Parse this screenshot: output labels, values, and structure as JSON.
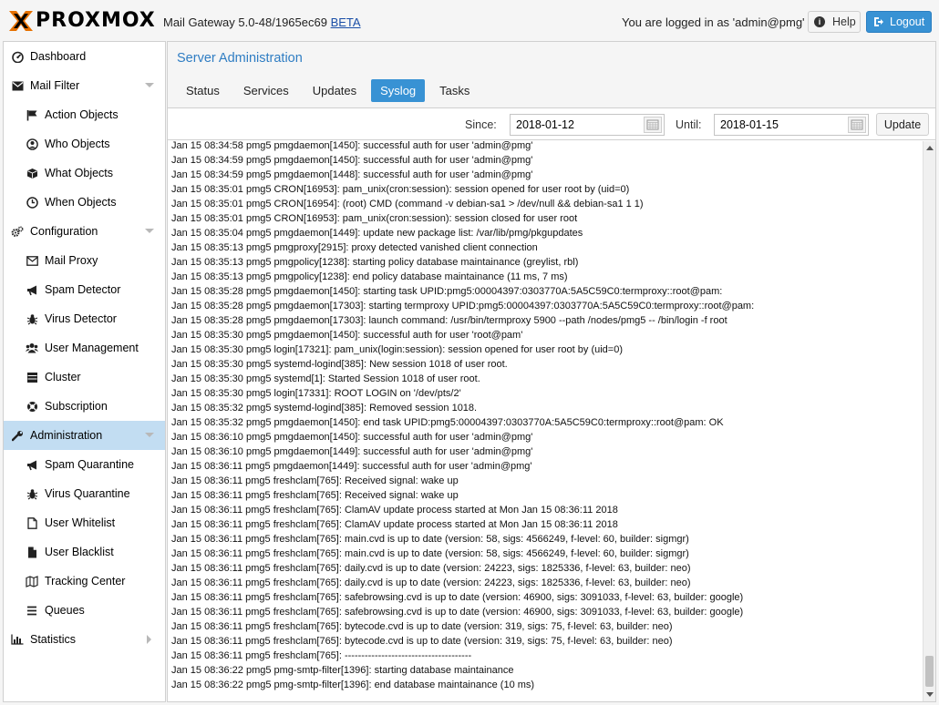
{
  "header": {
    "brand": "PROXMOX",
    "version_text": "Mail Gateway 5.0-48/1965ec69",
    "beta_link": "BETA",
    "logged_in_text": "You are logged in as 'admin@pmg'",
    "help_label": "Help",
    "logout_label": "Logout"
  },
  "sidebar": {
    "items": [
      {
        "label": "Dashboard",
        "icon": "dashboard-icon"
      },
      {
        "label": "Mail Filter",
        "icon": "envelope-icon"
      },
      {
        "label": "Action Objects",
        "icon": "flag-icon"
      },
      {
        "label": "Who Objects",
        "icon": "user-circle-icon"
      },
      {
        "label": "What Objects",
        "icon": "cube-icon"
      },
      {
        "label": "When Objects",
        "icon": "clock-icon"
      },
      {
        "label": "Configuration",
        "icon": "cogs-icon"
      },
      {
        "label": "Mail Proxy",
        "icon": "envelope-outline-icon"
      },
      {
        "label": "Spam Detector",
        "icon": "bullhorn-icon"
      },
      {
        "label": "Virus Detector",
        "icon": "bug-icon"
      },
      {
        "label": "User Management",
        "icon": "users-icon"
      },
      {
        "label": "Cluster",
        "icon": "server-icon"
      },
      {
        "label": "Subscription",
        "icon": "support-icon"
      },
      {
        "label": "Administration",
        "icon": "wrench-icon"
      },
      {
        "label": "Spam Quarantine",
        "icon": "bullhorn-icon"
      },
      {
        "label": "Virus Quarantine",
        "icon": "bug-icon"
      },
      {
        "label": "User Whitelist",
        "icon": "file-icon"
      },
      {
        "label": "User Blacklist",
        "icon": "file-solid-icon"
      },
      {
        "label": "Tracking Center",
        "icon": "map-icon"
      },
      {
        "label": "Queues",
        "icon": "list-icon"
      },
      {
        "label": "Statistics",
        "icon": "bar-chart-icon"
      }
    ]
  },
  "main": {
    "title": "Server Administration",
    "tabs": [
      "Status",
      "Services",
      "Updates",
      "Syslog",
      "Tasks"
    ],
    "active_tab": "Syslog",
    "since_label": "Since:",
    "since_value": "2018-01-12",
    "until_label": "Until:",
    "until_value": "2018-01-15",
    "update_label": "Update"
  },
  "log": [
    "Jan 15 08:34:58 pmg5 pmgdaemon[1450]: successful auth for user 'admin@pmg'",
    "Jan 15 08:34:59 pmg5 pmgdaemon[1450]: successful auth for user 'admin@pmg'",
    "Jan 15 08:34:59 pmg5 pmgdaemon[1448]: successful auth for user 'admin@pmg'",
    "Jan 15 08:35:01 pmg5 CRON[16953]: pam_unix(cron:session): session opened for user root by (uid=0)",
    "Jan 15 08:35:01 pmg5 CRON[16954]: (root) CMD (command -v debian-sa1 > /dev/null && debian-sa1 1 1)",
    "Jan 15 08:35:01 pmg5 CRON[16953]: pam_unix(cron:session): session closed for user root",
    "Jan 15 08:35:04 pmg5 pmgdaemon[1449]: update new package list: /var/lib/pmg/pkgupdates",
    "Jan 15 08:35:13 pmg5 pmgproxy[2915]: proxy detected vanished client connection",
    "Jan 15 08:35:13 pmg5 pmgpolicy[1238]: starting policy database maintainance (greylist, rbl)",
    "Jan 15 08:35:13 pmg5 pmgpolicy[1238]: end policy database maintainance (11 ms, 7 ms)",
    "Jan 15 08:35:28 pmg5 pmgdaemon[1450]: starting task UPID:pmg5:00004397:0303770A:5A5C59C0:termproxy::root@pam:",
    "Jan 15 08:35:28 pmg5 pmgdaemon[17303]: starting termproxy UPID:pmg5:00004397:0303770A:5A5C59C0:termproxy::root@pam:",
    "Jan 15 08:35:28 pmg5 pmgdaemon[17303]: launch command: /usr/bin/termproxy 5900 --path /nodes/pmg5 -- /bin/login -f root",
    "Jan 15 08:35:30 pmg5 pmgdaemon[1450]: successful auth for user 'root@pam'",
    "Jan 15 08:35:30 pmg5 login[17321]: pam_unix(login:session): session opened for user root by (uid=0)",
    "Jan 15 08:35:30 pmg5 systemd-logind[385]: New session 1018 of user root.",
    "Jan 15 08:35:30 pmg5 systemd[1]: Started Session 1018 of user root.",
    "Jan 15 08:35:30 pmg5 login[17331]: ROOT LOGIN  on '/dev/pts/2'",
    "Jan 15 08:35:32 pmg5 systemd-logind[385]: Removed session 1018.",
    "Jan 15 08:35:32 pmg5 pmgdaemon[1450]: end task UPID:pmg5:00004397:0303770A:5A5C59C0:termproxy::root@pam: OK",
    "Jan 15 08:36:10 pmg5 pmgdaemon[1450]: successful auth for user 'admin@pmg'",
    "Jan 15 08:36:10 pmg5 pmgdaemon[1449]: successful auth for user 'admin@pmg'",
    "Jan 15 08:36:11 pmg5 pmgdaemon[1449]: successful auth for user 'admin@pmg'",
    "Jan 15 08:36:11 pmg5 freshclam[765]: Received signal: wake up",
    "Jan 15 08:36:11 pmg5 freshclam[765]: Received signal: wake up",
    "Jan 15 08:36:11 pmg5 freshclam[765]: ClamAV update process started at Mon Jan 15 08:36:11 2018",
    "Jan 15 08:36:11 pmg5 freshclam[765]: ClamAV update process started at Mon Jan 15 08:36:11 2018",
    "Jan 15 08:36:11 pmg5 freshclam[765]: main.cvd is up to date (version: 58, sigs: 4566249, f-level: 60, builder: sigmgr)",
    "Jan 15 08:36:11 pmg5 freshclam[765]: main.cvd is up to date (version: 58, sigs: 4566249, f-level: 60, builder: sigmgr)",
    "Jan 15 08:36:11 pmg5 freshclam[765]: daily.cvd is up to date (version: 24223, sigs: 1825336, f-level: 63, builder: neo)",
    "Jan 15 08:36:11 pmg5 freshclam[765]: daily.cvd is up to date (version: 24223, sigs: 1825336, f-level: 63, builder: neo)",
    "Jan 15 08:36:11 pmg5 freshclam[765]: safebrowsing.cvd is up to date (version: 46900, sigs: 3091033, f-level: 63, builder: google)",
    "Jan 15 08:36:11 pmg5 freshclam[765]: safebrowsing.cvd is up to date (version: 46900, sigs: 3091033, f-level: 63, builder: google)",
    "Jan 15 08:36:11 pmg5 freshclam[765]: bytecode.cvd is up to date (version: 319, sigs: 75, f-level: 63, builder: neo)",
    "Jan 15 08:36:11 pmg5 freshclam[765]: bytecode.cvd is up to date (version: 319, sigs: 75, f-level: 63, builder: neo)",
    "Jan 15 08:36:11 pmg5 freshclam[765]: --------------------------------------",
    "Jan 15 08:36:22 pmg5 pmg-smtp-filter[1396]: starting database maintainance",
    "Jan 15 08:36:22 pmg5 pmg-smtp-filter[1396]: end database maintainance (10 ms)"
  ]
}
